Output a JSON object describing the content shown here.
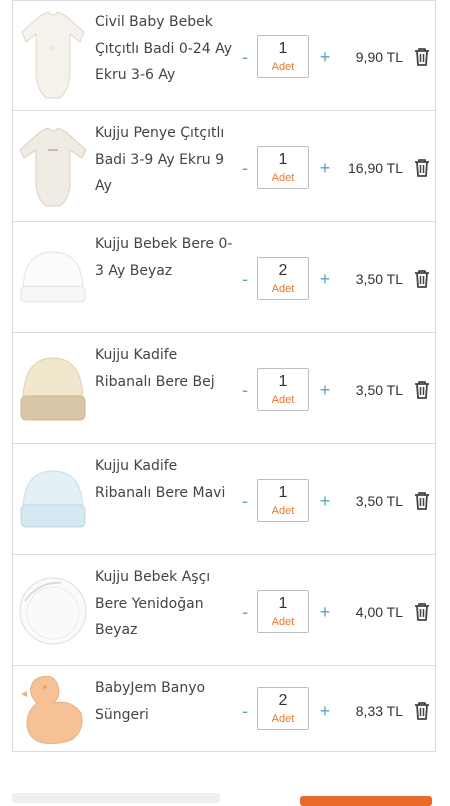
{
  "cart": {
    "items": [
      {
        "title": "Civil Baby Bebek Çıtçıtlı Badi 0-24 Ay Ekru 3-6 Ay",
        "quantity": "1",
        "unit": "Adet",
        "price": "9,90 TL",
        "image": "bodysuit-cream"
      },
      {
        "title": "Kujju Penye Çıtçıtlı Badi 3-9 Ay Ekru 9 Ay",
        "quantity": "1",
        "unit": "Adet",
        "price": "16,90 TL",
        "image": "bodysuit-ecru"
      },
      {
        "title": "Kujju Bebek Bere 0-3 Ay Beyaz",
        "quantity": "2",
        "unit": "Adet",
        "price": "3,50 TL",
        "image": "hat-white"
      },
      {
        "title": "Kujju Kadife Ribanalı Bere Bej",
        "quantity": "1",
        "unit": "Adet",
        "price": "3,50 TL",
        "image": "hat-beige"
      },
      {
        "title": "Kujju Kadife Ribanalı Bere Mavi",
        "quantity": "1",
        "unit": "Adet",
        "price": "3,50 TL",
        "image": "hat-blue"
      },
      {
        "title": "Kujju Bebek Aşçı Bere Yenidoğan Beyaz",
        "quantity": "1",
        "unit": "Adet",
        "price": "4,00 TL",
        "image": "bib-white"
      },
      {
        "title": "BabyJem Banyo Süngeri",
        "quantity": "2",
        "unit": "Adet",
        "price": "8,33 TL",
        "image": "duck-sponge"
      }
    ],
    "minus_symbol": "-",
    "plus_symbol": "+"
  },
  "colors": {
    "accent_orange": "#e8692a",
    "control_blue": "#5aa0c8",
    "border": "#dcdcdc"
  }
}
